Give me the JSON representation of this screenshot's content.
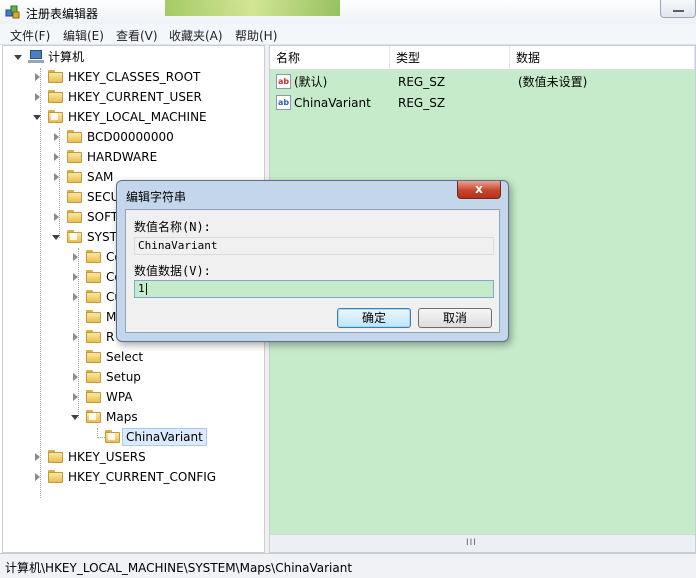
{
  "window": {
    "title": "注册表编辑器"
  },
  "menu": {
    "items": [
      "文件(F)",
      "编辑(E)",
      "查看(V)",
      "收藏夹(A)",
      "帮助(H)"
    ]
  },
  "tree": {
    "root": "计算机",
    "nodes": [
      {
        "label": "HKEY_CLASSES_ROOT"
      },
      {
        "label": "HKEY_CURRENT_USER"
      },
      {
        "label": "HKEY_LOCAL_MACHINE"
      },
      {
        "label": "BCD00000000"
      },
      {
        "label": "HARDWARE"
      },
      {
        "label": "SAM"
      },
      {
        "label": "SECU"
      },
      {
        "label": "SOFT"
      },
      {
        "label": "SYST"
      },
      {
        "label": "Co"
      },
      {
        "label": "Co"
      },
      {
        "label": "Cu"
      },
      {
        "label": "M"
      },
      {
        "label": "R"
      },
      {
        "label": "Select"
      },
      {
        "label": "Setup"
      },
      {
        "label": "WPA"
      },
      {
        "label": "Maps"
      },
      {
        "label": "ChinaVariant"
      },
      {
        "label": "HKEY_USERS"
      },
      {
        "label": "HKEY_CURRENT_CONFIG"
      }
    ]
  },
  "values": {
    "columns": [
      "名称",
      "类型",
      "数据"
    ],
    "rows": [
      {
        "name": "(默认)",
        "type": "REG_SZ",
        "data": "(数值未设置)",
        "icon": "ab"
      },
      {
        "name": "ChinaVariant",
        "type": "REG_SZ",
        "data": "",
        "icon": "ab"
      }
    ],
    "scrollbar_grip": "III"
  },
  "status": {
    "path": "计算机\\HKEY_LOCAL_MACHINE\\SYSTEM\\Maps\\ChinaVariant"
  },
  "dialog": {
    "title": "编辑字符串",
    "close_label": "x",
    "name_label": "数值名称(N):",
    "name_value": "ChinaVariant",
    "data_label": "数值数据(V):",
    "data_value": "1",
    "ok_label": "确定",
    "cancel_label": "取消"
  },
  "colors": {
    "pane_background": "#c6ebca",
    "close_button": "#c7452c"
  }
}
